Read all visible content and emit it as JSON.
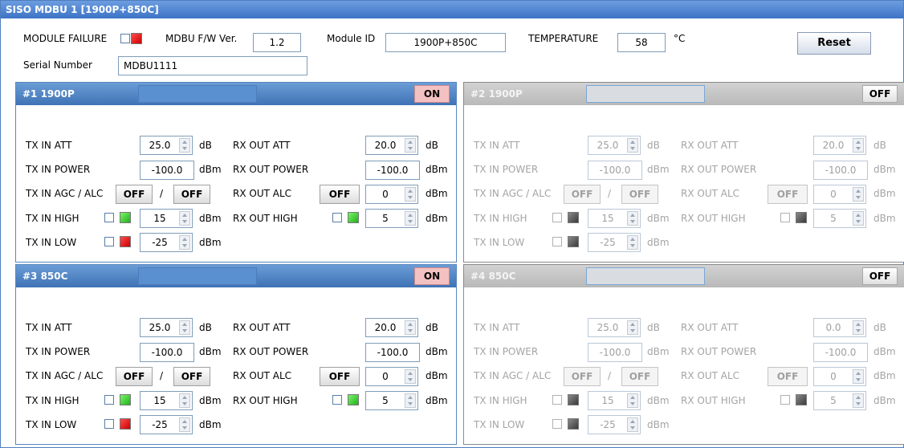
{
  "window": {
    "title": "SISO MDBU 1 [1900P+850C]"
  },
  "header": {
    "module_failure_label": "MODULE FAILURE",
    "fw_label": "MDBU F/W Ver.",
    "fw_value": "1.2",
    "module_id_label": "Module ID",
    "module_id_value": "1900P+850C",
    "temperature_label": "TEMPERATURE",
    "temperature_value": "58",
    "temperature_unit": "°C",
    "reset_label": "Reset",
    "serial_label": "Serial Number",
    "serial_value": "MDBU1111"
  },
  "panels": [
    {
      "title": "#1 1900P",
      "state": "ON",
      "tx_att_label": "TX IN ATT",
      "tx_att": "25.0",
      "tx_att_unit": "dB",
      "rx_att_label": "RX OUT ATT",
      "rx_att": "20.0",
      "rx_att_unit": "dB",
      "tx_power_label": "TX IN POWER",
      "tx_power": "-100.0",
      "tx_power_unit": "dBm",
      "rx_power_label": "RX OUT POWER",
      "rx_power": "-100.0",
      "rx_power_unit": "dBm",
      "tx_agc_label": "TX IN AGC / ALC",
      "tx_agc": "OFF",
      "tx_alc": "OFF",
      "slash": "/",
      "rx_alc_label": "RX OUT ALC",
      "rx_alc": "OFF",
      "rx_alc_value": "0",
      "rx_alc_unit": "dBm",
      "tx_high_label": "TX IN HIGH",
      "tx_high": "15",
      "tx_high_unit": "dBm",
      "rx_high_label": "RX OUT HIGH",
      "rx_high": "5",
      "rx_high_unit": "dBm",
      "tx_low_label": "TX IN LOW",
      "tx_low": "-25",
      "tx_low_unit": "dBm"
    },
    {
      "title": "#2 1900P",
      "state": "OFF",
      "tx_att_label": "TX IN ATT",
      "tx_att": "25.0",
      "tx_att_unit": "dB",
      "rx_att_label": "RX OUT ATT",
      "rx_att": "20.0",
      "rx_att_unit": "dB",
      "tx_power_label": "TX IN POWER",
      "tx_power": "-100.0",
      "tx_power_unit": "dBm",
      "rx_power_label": "RX OUT POWER",
      "rx_power": "-100.0",
      "rx_power_unit": "dBm",
      "tx_agc_label": "TX IN AGC / ALC",
      "tx_agc": "OFF",
      "tx_alc": "OFF",
      "slash": "/",
      "rx_alc_label": "RX OUT ALC",
      "rx_alc": "OFF",
      "rx_alc_value": "0",
      "rx_alc_unit": "dBm",
      "tx_high_label": "TX IN HIGH",
      "tx_high": "15",
      "tx_high_unit": "dBm",
      "rx_high_label": "RX OUT HIGH",
      "rx_high": "5",
      "rx_high_unit": "dBm",
      "tx_low_label": "TX IN LOW",
      "tx_low": "-25",
      "tx_low_unit": "dBm"
    },
    {
      "title": "#3 850C",
      "state": "ON",
      "tx_att_label": "TX IN ATT",
      "tx_att": "25.0",
      "tx_att_unit": "dB",
      "rx_att_label": "RX OUT ATT",
      "rx_att": "20.0",
      "rx_att_unit": "dB",
      "tx_power_label": "TX IN POWER",
      "tx_power": "-100.0",
      "tx_power_unit": "dBm",
      "rx_power_label": "RX OUT POWER",
      "rx_power": "-100.0",
      "rx_power_unit": "dBm",
      "tx_agc_label": "TX IN AGC / ALC",
      "tx_agc": "OFF",
      "tx_alc": "OFF",
      "slash": "/",
      "rx_alc_label": "RX OUT ALC",
      "rx_alc": "OFF",
      "rx_alc_value": "0",
      "rx_alc_unit": "dBm",
      "tx_high_label": "TX IN HIGH",
      "tx_high": "15",
      "tx_high_unit": "dBm",
      "rx_high_label": "RX OUT HIGH",
      "rx_high": "5",
      "rx_high_unit": "dBm",
      "tx_low_label": "TX IN LOW",
      "tx_low": "-25",
      "tx_low_unit": "dBm"
    },
    {
      "title": "#4 850C",
      "state": "OFF",
      "tx_att_label": "TX IN ATT",
      "tx_att": "25.0",
      "tx_att_unit": "dB",
      "rx_att_label": "RX OUT ATT",
      "rx_att": "0.0",
      "rx_att_unit": "dB",
      "tx_power_label": "TX IN POWER",
      "tx_power": "-100.0",
      "tx_power_unit": "dBm",
      "rx_power_label": "RX OUT POWER",
      "rx_power": "-100.0",
      "rx_power_unit": "dBm",
      "tx_agc_label": "TX IN AGC / ALC",
      "tx_agc": "OFF",
      "tx_alc": "OFF",
      "slash": "/",
      "rx_alc_label": "RX OUT ALC",
      "rx_alc": "OFF",
      "rx_alc_value": "0",
      "rx_alc_unit": "dBm",
      "tx_high_label": "TX IN HIGH",
      "tx_high": "15",
      "tx_high_unit": "dBm",
      "rx_high_label": "RX OUT HIGH",
      "rx_high": "5",
      "rx_high_unit": "dBm",
      "tx_low_label": "TX IN LOW",
      "tx_low": "-25",
      "tx_low_unit": "dBm"
    }
  ],
  "colors": {
    "title_bar": "#3d74c6",
    "on_badge": "#f3c1c1",
    "alarm_red": "#e00000",
    "ok_green": "#2fd12a",
    "inactive_gray": "#5a5a5a"
  },
  "icons": [
    "checkbox-icon",
    "alarm-led-icon",
    "spin-arrows-icon"
  ]
}
